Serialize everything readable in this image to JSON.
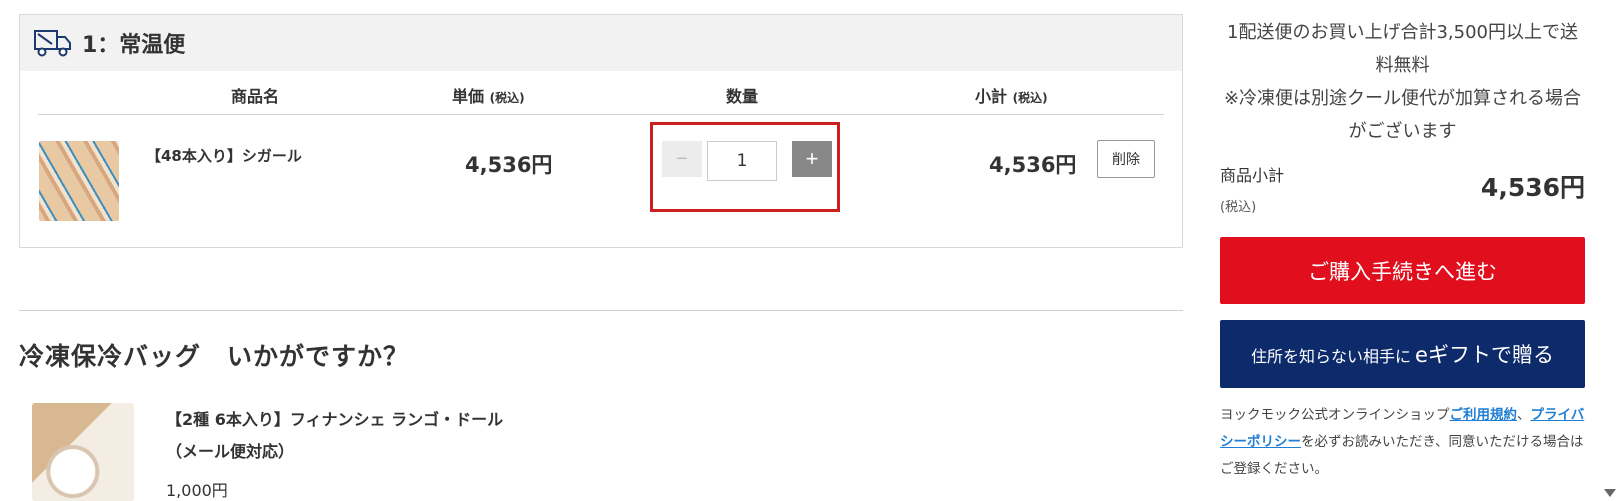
{
  "cart": {
    "title": "1：常温便",
    "columns": {
      "product": "商品名",
      "unit_price": "単価",
      "unit_price_tax": "(税込)",
      "quantity": "数量",
      "subtotal": "小計",
      "subtotal_tax": "(税込)"
    },
    "item": {
      "name": "【48本入り】シガール",
      "unit_price": "4,536円",
      "quantity_value": "1",
      "minus_label": "−",
      "plus_label": "+",
      "subtotal": "4,536円",
      "delete_label": "削除"
    }
  },
  "recommend": {
    "title": "冷凍保冷バッグ　いかがですか？",
    "item_name": "【2種 6本入り】フィナンシェ ランゴ・ドール（メール便対応）",
    "item_price": "1,000円"
  },
  "summary": {
    "notice_line1": "1配送便のお買い上げ合計3,500円以上で送料無料",
    "notice_line2": "※冷凍便は別途クール便代が加算される場合がございます",
    "subtotal_label": "商品小計",
    "subtotal_tax": "(税込)",
    "subtotal_value": "4,536円",
    "checkout_label": "ご購入手続きへ進む",
    "gift_label_prefix": "住所を知らない相手に",
    "gift_label_main": "eギフトで贈る",
    "terms_prefix": "ヨックモック公式オンラインショップ",
    "terms_link": "ご利用規約",
    "terms_sep": "、",
    "privacy_link": "プライバシーポリシー",
    "terms_suffix": "を必ずお読みいただき、同意いただける場合はご登録ください。"
  },
  "colors": {
    "checkout": "#e10f1e",
    "gift": "#0d2a6b",
    "highlight": "#cc1f1f",
    "link": "#1f7fd4"
  },
  "icons": {
    "truck": "delivery-truck-icon",
    "scroll": "scroll-down-arrow-icon"
  }
}
